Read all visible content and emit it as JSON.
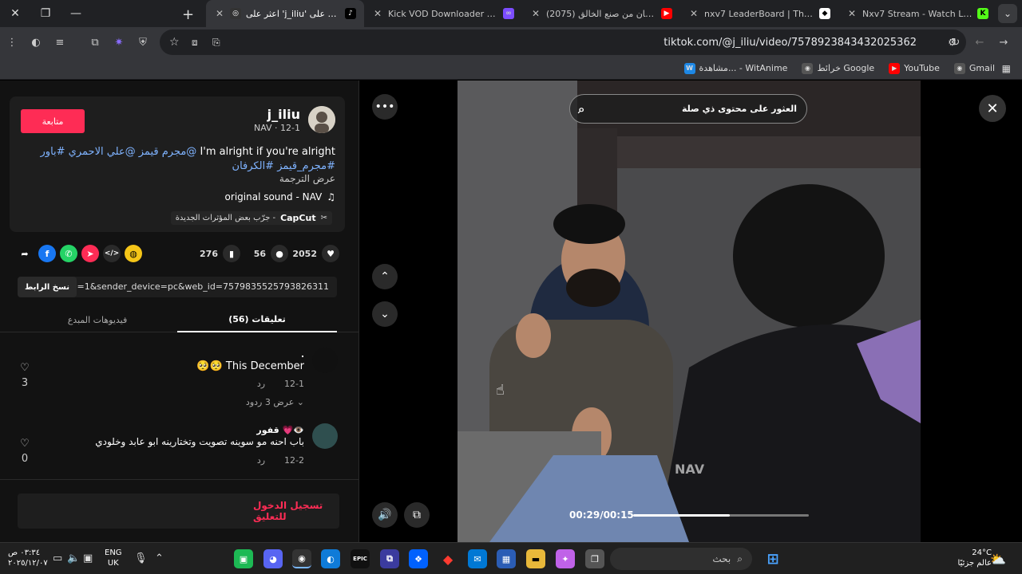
{
  "browser": {
    "tabs": [
      {
        "title": "اعثر على 'j_iliu' على TikTok |",
        "favicon_color": "#000000",
        "active": true
      },
      {
        "title": "Kick VOD Downloader - Stream",
        "favicon_color": "#7c4dff",
        "active": false
      },
      {
        "title": "(2075) دخلنا مكان من صنع الخالق",
        "favicon_color": "#ff0000",
        "active": false
      },
      {
        "title": "nxv7 LeaderBoard | The best Ch",
        "favicon_color": "#ffffff",
        "active": false
      },
      {
        "title": "Nxv7 Stream - Watch Live on Ki",
        "favicon_color": "#53fc18",
        "active": false
      }
    ],
    "new_tab": "+",
    "url": "tiktok.com/@j_iliu/video/7578923843432025362",
    "bookmarks": [
      {
        "label": "Gmail",
        "color": "#ea4335"
      },
      {
        "label": "YouTube",
        "color": "#ff0000"
      },
      {
        "label": "خرائط Google",
        "color": "#34a853"
      },
      {
        "label": "مشاهدة... - WitAnime",
        "color": "#1e88e5"
      }
    ]
  },
  "post": {
    "username": "j_iliu",
    "subline": "NAV · 12-1",
    "follow_label": "متابعة",
    "caption_main": "I'm alright if you're alright",
    "caption_tags": "@مجرم قيمز @علي الاحمري #باور #مجرم_قيمز #الكرفان",
    "translate_label": "عرض الترجمة",
    "sound": "original sound - NAV",
    "capcut_brand": "CapCut",
    "capcut_text": "جرّب بعض المؤثرات الجديدة -"
  },
  "actions": {
    "likes": "2052",
    "comments": "56",
    "saves": "276"
  },
  "share": {
    "url": "...p=1&sender_device=pc&web_id=7579835525793826311",
    "copy_label": "نسخ الرابط"
  },
  "panel_tabs": {
    "comments": "تعليقات (56)",
    "creator_videos": "فيديوهات المبدع"
  },
  "comments": [
    {
      "name": ".",
      "text": "This December 🥺🥺",
      "date": "12-1",
      "reply": "رد",
      "likes": "3",
      "avatar_color": "#111111"
    },
    {
      "name": "قفور 💗👁️",
      "text": "باب احنه مو سوينه تصويت وتختارينه ابو عابد وخلودي",
      "date": "12-2",
      "reply": "رد",
      "likes": "0",
      "avatar_color": "#2f4f4f"
    }
  ],
  "replies_label": "عرض 3 ردود",
  "login_label": "تسجيل الدخول للتعليق",
  "video": {
    "search_placeholder": "العثور على محتوى ذي صلة",
    "timecode": "00:29/00:15",
    "progress": 0.55,
    "watermark": "NAV"
  },
  "taskbar": {
    "search_label": "بحث",
    "weather_temp": "24°C",
    "weather_text": "عالم جزئيًا",
    "lang_top": "ENG",
    "lang_bottom": "UK",
    "time": "٠٣:٣٤ ص",
    "date": "٢٠٢٥/١٢/٠٧"
  },
  "colors": {
    "accent": "#fe2c55",
    "hashtag": "#7fb3ff"
  }
}
